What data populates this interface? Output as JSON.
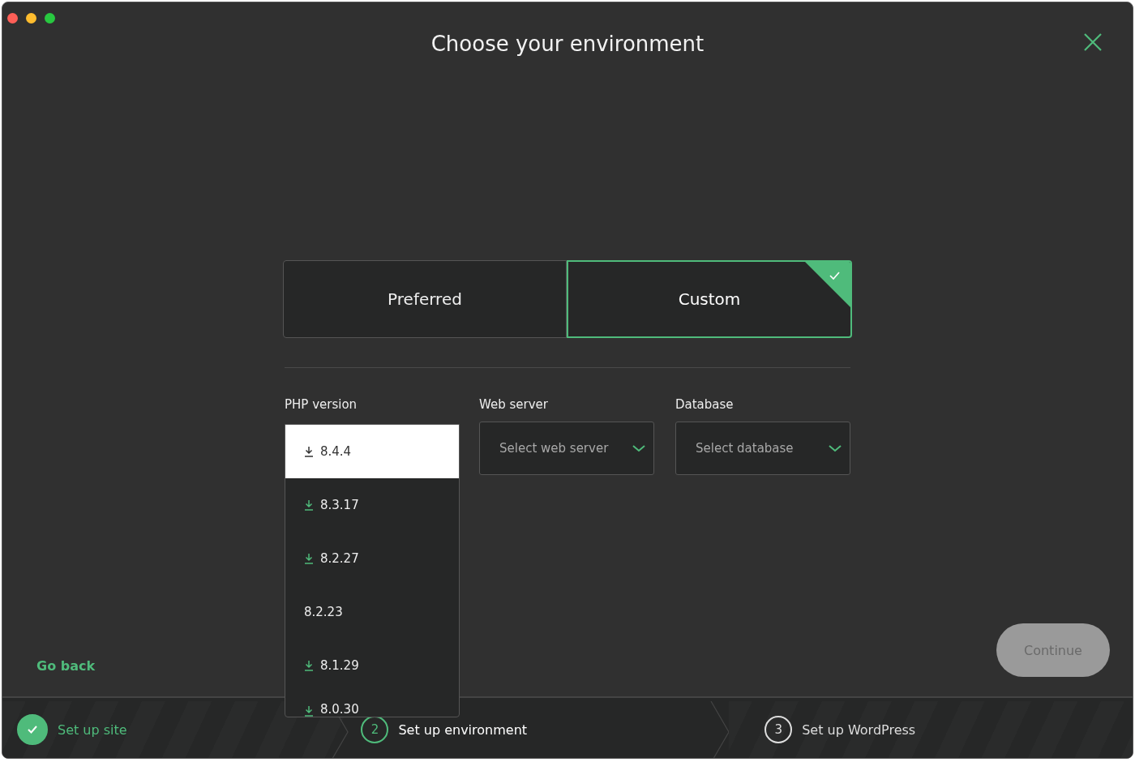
{
  "window": {
    "title": "Choose your environment"
  },
  "environment_options": [
    {
      "label": "Preferred",
      "selected": false
    },
    {
      "label": "Custom",
      "selected": true
    }
  ],
  "fields": [
    {
      "label": "PHP version",
      "kind": "list",
      "options": [
        {
          "label": "8.4.4",
          "downloadable": true,
          "selected": true
        },
        {
          "label": "8.3.17",
          "downloadable": true,
          "selected": false
        },
        {
          "label": "8.2.27",
          "downloadable": true,
          "selected": false
        },
        {
          "label": "8.2.23",
          "downloadable": false,
          "selected": false
        },
        {
          "label": "8.1.29",
          "downloadable": true,
          "selected": false
        },
        {
          "label": "8.0.30",
          "downloadable": true,
          "selected": false
        }
      ]
    },
    {
      "label": "Web server",
      "kind": "select",
      "placeholder": "Select web server"
    },
    {
      "label": "Database",
      "kind": "select",
      "placeholder": "Select database"
    }
  ],
  "go_back": "Go back",
  "continue": {
    "label": "Continue",
    "disabled": true
  },
  "steps": [
    {
      "label": "Set up site",
      "kind": "done"
    },
    {
      "number": "2",
      "label": "Set up environment",
      "kind": "current"
    },
    {
      "number": "3",
      "label": "Set up WordPress",
      "kind": "upcoming"
    }
  ]
}
